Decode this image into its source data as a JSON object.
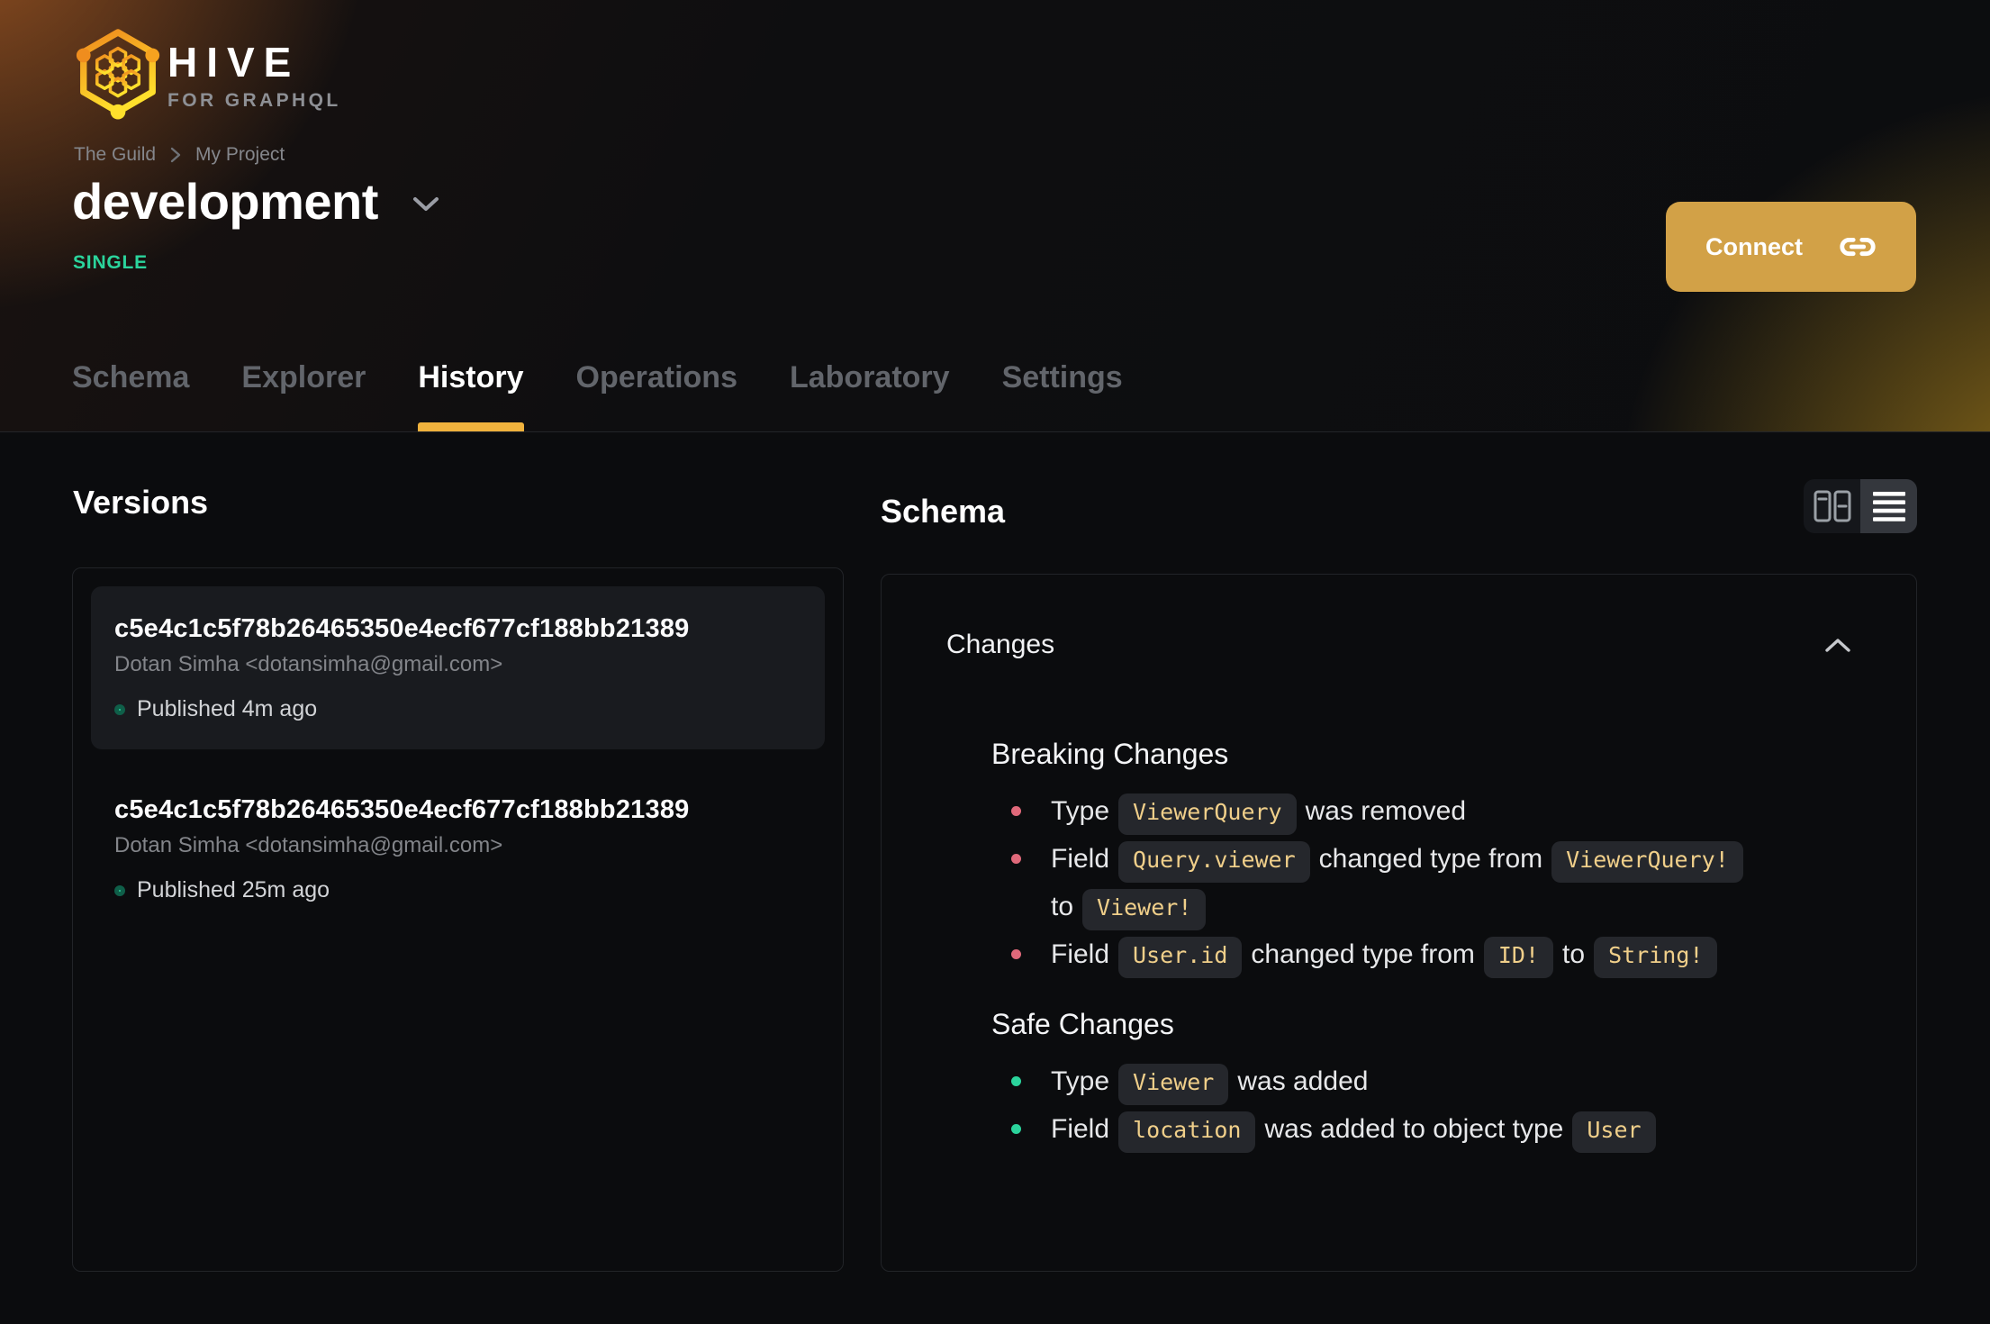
{
  "brand": {
    "name": "HIVE",
    "tagline": "FOR GRAPHQL"
  },
  "breadcrumb": {
    "items": [
      {
        "label": "The Guild"
      },
      {
        "label": "My Project"
      }
    ]
  },
  "project": {
    "title": "development",
    "badge": "SINGLE"
  },
  "connect": {
    "label": "Connect"
  },
  "tabs": [
    {
      "label": "Schema"
    },
    {
      "label": "Explorer"
    },
    {
      "label": "History"
    },
    {
      "label": "Operations"
    },
    {
      "label": "Laboratory"
    },
    {
      "label": "Settings"
    }
  ],
  "active_tab": "History",
  "versions": {
    "heading": "Versions",
    "items": [
      {
        "hash": "c5e4c1c5f78b26465350e4ecf677cf188bb21389",
        "author": "Dotan Simha <dotansimha@gmail.com>",
        "status": "Published 4m ago"
      },
      {
        "hash": "c5e4c1c5f78b26465350e4ecf677cf188bb21389",
        "author": "Dotan Simha <dotansimha@gmail.com>",
        "status": "Published 25m ago"
      }
    ]
  },
  "schema": {
    "heading": "Schema",
    "changes": {
      "label": "Changes",
      "breaking": {
        "title": "Breaking Changes",
        "items": [
          {
            "segments": [
              {
                "type": "text",
                "value": "Type"
              },
              {
                "type": "code",
                "value": "ViewerQuery"
              },
              {
                "type": "text",
                "value": "was removed"
              }
            ]
          },
          {
            "segments": [
              {
                "type": "text",
                "value": "Field"
              },
              {
                "type": "code",
                "value": "Query.viewer"
              },
              {
                "type": "text",
                "value": "changed type from"
              },
              {
                "type": "code",
                "value": "ViewerQuery!"
              },
              {
                "type": "text",
                "value": "to"
              },
              {
                "type": "code",
                "value": "Viewer!"
              }
            ]
          },
          {
            "segments": [
              {
                "type": "text",
                "value": "Field"
              },
              {
                "type": "code",
                "value": "User.id"
              },
              {
                "type": "text",
                "value": "changed type from"
              },
              {
                "type": "code",
                "value": "ID!"
              },
              {
                "type": "text",
                "value": "to"
              },
              {
                "type": "code",
                "value": "String!"
              }
            ]
          }
        ]
      },
      "safe": {
        "title": "Safe Changes",
        "items": [
          {
            "segments": [
              {
                "type": "text",
                "value": "Type"
              },
              {
                "type": "code",
                "value": "Viewer"
              },
              {
                "type": "text",
                "value": "was added"
              }
            ]
          },
          {
            "segments": [
              {
                "type": "text",
                "value": "Field"
              },
              {
                "type": "code",
                "value": "location"
              },
              {
                "type": "text",
                "value": "was added to object type"
              },
              {
                "type": "code",
                "value": "User"
              }
            ]
          }
        ]
      }
    }
  },
  "colors": {
    "connect_button": "#d2a147",
    "tab_underline": "#f0b23d",
    "badge_green": "#2bd49c",
    "status_dot": "#2bd49c",
    "breaking_bullet": "#e0697a",
    "safe_bullet": "#2bd49c",
    "code_text": "#f0cf8a"
  }
}
